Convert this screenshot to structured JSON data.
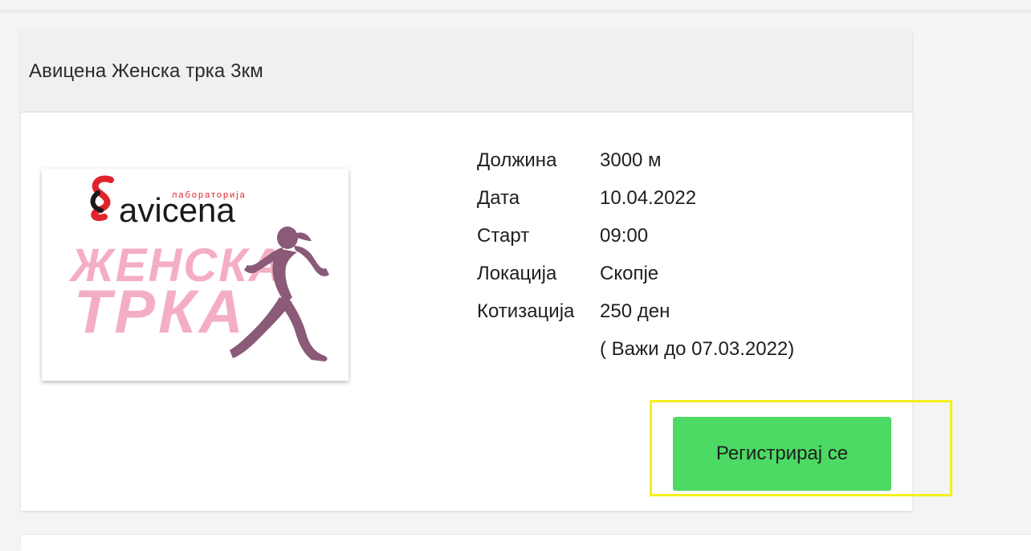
{
  "event": {
    "title": "Авицена Женска трка 3км",
    "image": {
      "alt": "Авицена Женска трка",
      "logo_text": "avicena",
      "logo_subtext": "лабораторија",
      "headline_line1": "ЖЕНСКА",
      "headline_line2": "ТРКА"
    },
    "details": [
      {
        "label": "Должина",
        "value": "3000 м"
      },
      {
        "label": "Дата",
        "value": "10.04.2022"
      },
      {
        "label": "Старт",
        "value": "09:00"
      },
      {
        "label": "Локација",
        "value": "Скопје"
      },
      {
        "label": "Котизација",
        "value": "250 ден"
      },
      {
        "label": "",
        "value": "( Важи до 07.03.2022)"
      }
    ],
    "register_label": "Регистрирај се"
  },
  "colors": {
    "register_button": "#4cd964",
    "highlight": "#f5ef1e",
    "headline_pink": "#f4aec3",
    "runner": "#8a5a78",
    "logo_red": "#e1232d"
  }
}
